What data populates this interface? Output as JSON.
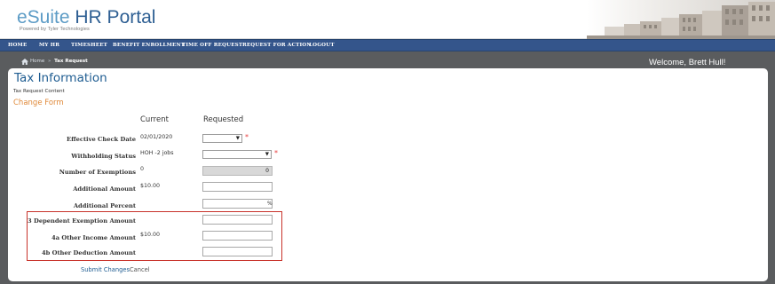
{
  "header": {
    "logo_part1": "eSuite",
    "logo_part2": "HR Portal",
    "logo_subtitle": "Powered by Tyler Technologies"
  },
  "nav": {
    "items": [
      "HOME",
      "MY HR",
      "TIMESHEET",
      "BENEFIT ENROLLMENT",
      "TIME OFF REQUEST",
      "REQUEST FOR ACTION",
      "LOGOUT"
    ]
  },
  "breadcrumb": {
    "home": "Home",
    "separator": "»",
    "current": "Tax Request"
  },
  "welcome": "Welcome, Brett Hull!",
  "page": {
    "title": "Tax Information",
    "subtitle": "Tax Request Content",
    "section_title": "Change Form",
    "col_current": "Current",
    "col_requested": "Requested"
  },
  "rows": {
    "effective_check_date": {
      "label": "Effective Check Date",
      "current": "02/01/2020",
      "requested": "",
      "required_mark": "*"
    },
    "withholding_status": {
      "label": "Withholding Status",
      "current": "HOH -2 jobs",
      "requested": "",
      "required_mark": "*"
    },
    "number_of_exemptions": {
      "label": "Number of Exemptions",
      "current": "0",
      "requested": "0"
    },
    "additional_amount": {
      "label": "Additional Amount",
      "current": "$10.00",
      "requested": ""
    },
    "additional_percent": {
      "label": "Additional Percent",
      "current": "",
      "requested": "",
      "unit": "%"
    },
    "dependent_exemption": {
      "label": "3 Dependent Exemption Amount",
      "current": "",
      "requested": ""
    },
    "other_income": {
      "label": "4a Other Income Amount",
      "current": "$10.00",
      "requested": ""
    },
    "other_deduction": {
      "label": "4b Other Deduction Amount",
      "current": "",
      "requested": ""
    }
  },
  "actions": {
    "submit": "Submit Changes",
    "cancel": "Cancel"
  },
  "colors": {
    "nav_bg": "#34558b",
    "title_blue": "#1e5c91",
    "section_orange": "#e08a3a",
    "highlight_red": "#c8322a",
    "required_red": "#e63a3a",
    "page_bg": "#5a5c5e"
  },
  "icons": {
    "home": "home-icon",
    "dropdown": "chevron-down-icon"
  }
}
